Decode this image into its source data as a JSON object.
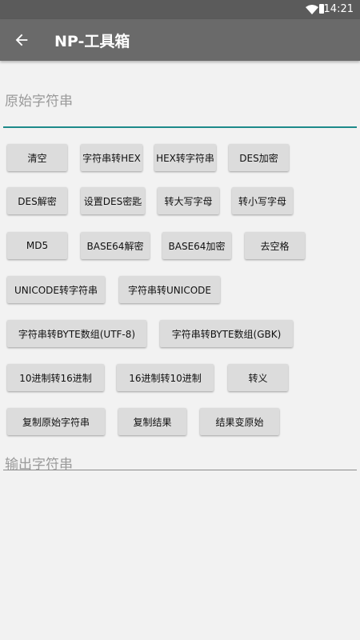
{
  "status": {
    "time": "14:21"
  },
  "appbar": {
    "title": "NP-工具箱"
  },
  "input": {
    "placeholder": "原始字符串"
  },
  "buttons": {
    "clear": "清空",
    "str_to_hex": "字符串转HEX",
    "hex_to_str": "HEX转字符串",
    "des_encrypt": "DES加密",
    "des_decrypt": "DES解密",
    "set_des_key": "设置DES密匙",
    "to_upper": "转大写字母",
    "to_lower": "转小写字母",
    "md5": "MD5",
    "base64_decode": "BASE64解密",
    "base64_encode": "BASE64加密",
    "trim_spaces": "去空格",
    "unicode_to_str": "UNICODE转字符串",
    "str_to_unicode": "字符串转UNICODE",
    "str_to_byte_utf8": "字符串转BYTE数组(UTF-8)",
    "str_to_byte_gbk": "字符串转BYTE数组(GBK)",
    "dec_to_hex": "10进制转16进制",
    "hex_to_dec": "16进制转10进制",
    "escape": "转义",
    "copy_original": "复制原始字符串",
    "copy_result": "复制结果",
    "result_to_original": "结果变原始"
  },
  "output": {
    "placeholder": "输出字符串"
  }
}
